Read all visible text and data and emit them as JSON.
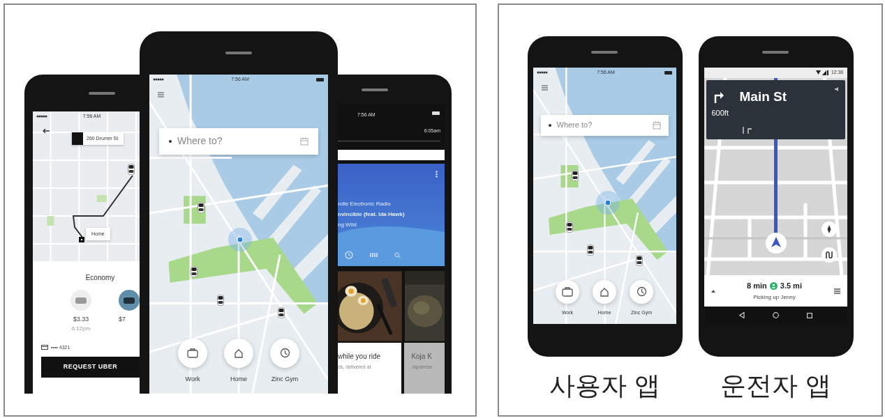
{
  "left_panel": {
    "rider_phone": {
      "status_time": "7:56 AM",
      "pickup": "260 Drumm St",
      "destination": "Home",
      "section_title": "Economy",
      "options": [
        {
          "price": "$3.33",
          "eta": "6:12pm",
          "selected": false
        },
        {
          "price": "$7",
          "selected": true
        }
      ],
      "payment": "•••• 4321",
      "request_button": "REQUEST UBER"
    },
    "home_phone": {
      "status_time": "7:56 AM",
      "search_placeholder": "Where to?",
      "shortcuts": [
        {
          "kind": "work",
          "label": "Work"
        },
        {
          "kind": "home",
          "label": "Home"
        },
        {
          "kind": "recent",
          "label": "Zinc Gym"
        }
      ]
    },
    "feed_phone": {
      "status_time": "7:56 AM",
      "eta": "6:05am",
      "music": {
        "station": "ndie Electronic Radio",
        "track": "nvincible (feat. Ida Hawk)",
        "artist": "ng Wild"
      },
      "cards": [
        {
          "title": "while you ride",
          "subtitle": "ds, delivered at",
          "dimmed": false
        },
        {
          "title": "Koja K",
          "subtitle": "Japanese",
          "dimmed": true
        }
      ]
    }
  },
  "right_panel": {
    "phones": [
      {
        "kind": "rider",
        "status_time": "7:56 AM",
        "search_placeholder": "Where to?",
        "shortcuts": [
          {
            "kind": "work",
            "label": "Work"
          },
          {
            "kind": "home",
            "label": "Home"
          },
          {
            "kind": "recent",
            "label": "Zinc Gym"
          }
        ],
        "caption": "사용자 앱"
      },
      {
        "kind": "driver",
        "status_time": "12:30",
        "turn_street": "Main St",
        "turn_distance": "600ft",
        "duration": "8 min",
        "distance": "3.5 mi",
        "status_text": "Picking up Jenny",
        "caption": "운전자 앱"
      }
    ]
  }
}
